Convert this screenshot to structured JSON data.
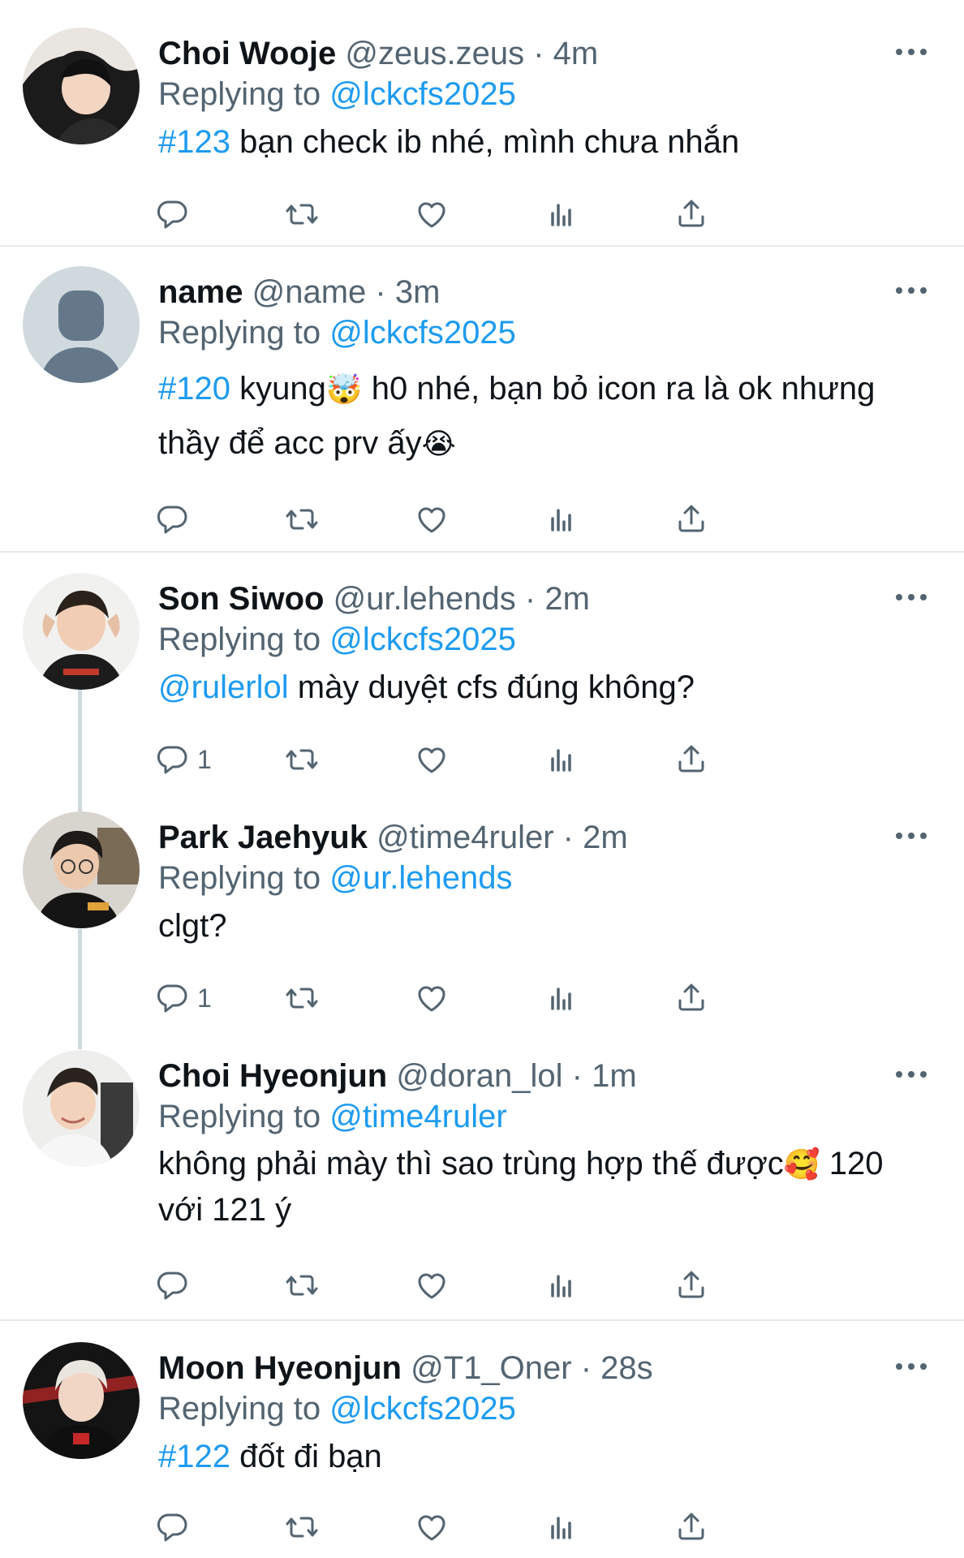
{
  "labels": {
    "replying_to": "Replying to"
  },
  "colors": {
    "link": "#1d9bf0",
    "meta": "#536471",
    "icon": "#536471",
    "divider": "#e7e9eb",
    "thread_line": "#cfd9de"
  },
  "icons": {
    "reply": "reply-icon",
    "retweet": "retweet-icon",
    "like": "heart-icon",
    "views": "views-icon",
    "share": "share-icon",
    "more": "more-icon"
  },
  "tweets": [
    {
      "name": "Choi Wooje",
      "handle": "@zeus.zeus",
      "sep": "·",
      "time": "4m",
      "reply_to": "@lckcfs2025",
      "tag": "#123",
      "text": " bạn check ib nhé, mình chưa nhắn",
      "emoji1": "",
      "text2": "",
      "emoji2": "",
      "reply_count": ""
    },
    {
      "name": "name",
      "handle": "@name",
      "sep": "·",
      "time": "3m",
      "reply_to": "@lckcfs2025",
      "tag": "#120",
      "text": " kyung",
      "emoji1": "🤯",
      "text2": " h0 nhé, bạn bỏ icon ra là ok nhưng thầy để acc prv ấy",
      "emoji2": "😭",
      "reply_count": ""
    },
    {
      "name": "Son Siwoo",
      "handle": "@ur.lehends",
      "sep": "·",
      "time": "2m",
      "reply_to": "@lckcfs2025",
      "tag": "@rulerlol",
      "text": " mày duyệt cfs đúng không?",
      "emoji1": "",
      "text2": "",
      "emoji2": "",
      "reply_count": "1"
    },
    {
      "name": "Park Jaehyuk",
      "handle": "@time4ruler",
      "sep": "·",
      "time": "2m",
      "reply_to": "@ur.lehends",
      "tag": "",
      "text": "clgt?",
      "emoji1": "",
      "text2": "",
      "emoji2": "",
      "reply_count": "1"
    },
    {
      "name": "Choi Hyeonjun",
      "handle": "@doran_lol",
      "sep": "·",
      "time": "1m",
      "reply_to": "@time4ruler",
      "tag": "",
      "text": "không phải mày thì sao trùng hợp thế được",
      "emoji1": "🥰",
      "text2": " 120 với 121 ý",
      "emoji2": "",
      "reply_count": ""
    },
    {
      "name": "Moon Hyeonjun",
      "handle": "@T1_Oner",
      "sep": "·",
      "time": "28s",
      "reply_to": "@lckcfs2025",
      "tag": "#122",
      "text": " đốt đi bạn",
      "emoji1": "",
      "text2": "",
      "emoji2": "",
      "reply_count": ""
    }
  ]
}
